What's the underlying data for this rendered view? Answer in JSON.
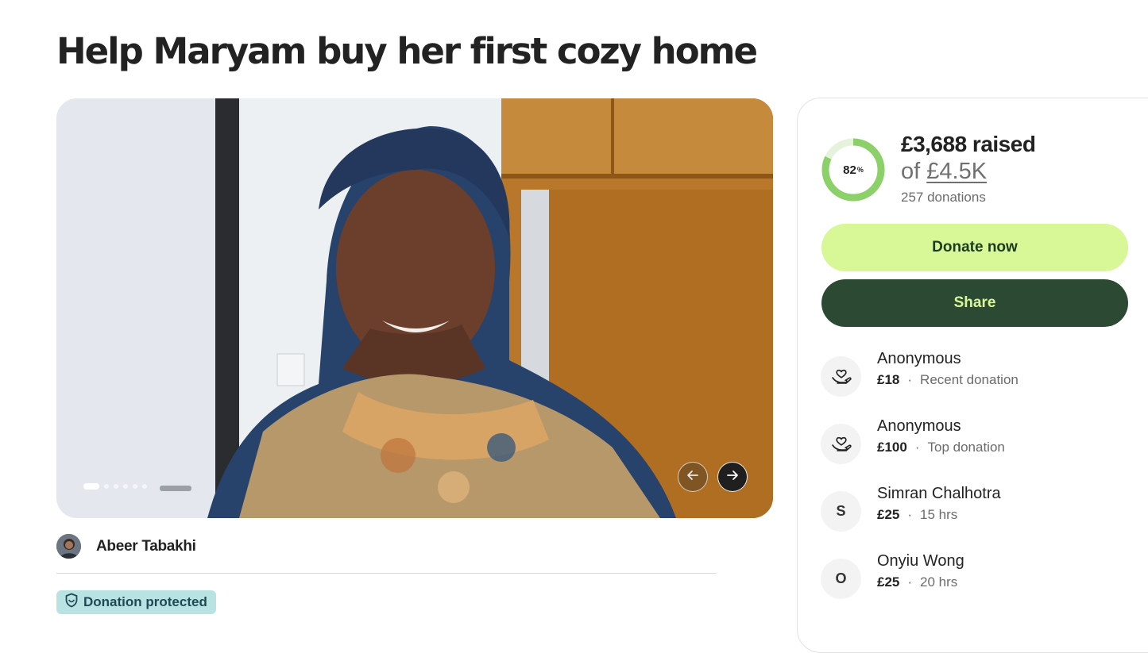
{
  "page": {
    "title": "Help Maryam buy her first cozy home"
  },
  "hero": {
    "slide_count": 6,
    "active_slide": 1,
    "photo_alt": "",
    "prev_icon": "arrow-left-icon",
    "next_icon": "arrow-right-icon"
  },
  "organizer": {
    "name": "Abeer Tabakhi"
  },
  "badge": {
    "label": "Donation protected",
    "icon": "shield-icon"
  },
  "progress": {
    "percent_value": 82,
    "percent_number": "82",
    "percent_sign": "%",
    "raised": "£3,688 raised",
    "goal_prefix": "of",
    "goal_amount": "£4.5K",
    "donation_count": "257 donations",
    "ring_color": "#8cd06a",
    "ring_track_color": "#e6f2dc"
  },
  "actions": {
    "donate_label": "Donate now",
    "share_label": "Share"
  },
  "colors": {
    "donate_bg": "#d8f796",
    "share_bg": "#2c4a33",
    "badge_bg": "#b9e3e3"
  },
  "donations": [
    {
      "name": "Anonymous",
      "amount": "£18",
      "separator": "·",
      "note": "Recent donation",
      "icon": "heart-hand-icon",
      "initial": ""
    },
    {
      "name": "Anonymous",
      "amount": "£100",
      "separator": "·",
      "note": "Top donation",
      "icon": "heart-hand-icon",
      "initial": ""
    },
    {
      "name": "Simran Chalhotra",
      "amount": "£25",
      "separator": "·",
      "note": "15 hrs",
      "icon": "initial-avatar",
      "initial": "S"
    },
    {
      "name": "Onyiu Wong",
      "amount": "£25",
      "separator": "·",
      "note": "20 hrs",
      "icon": "initial-avatar",
      "initial": "O"
    }
  ]
}
